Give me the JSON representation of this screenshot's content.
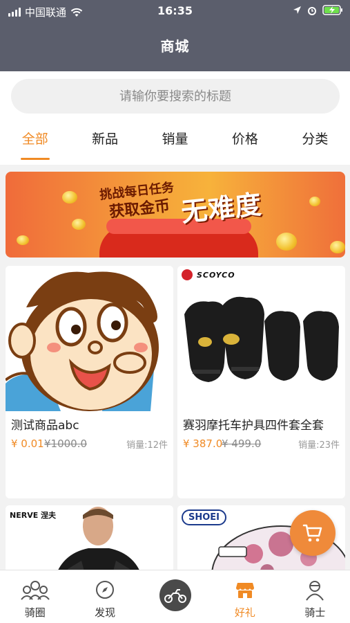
{
  "status_bar": {
    "carrier": "中国联通",
    "time": "16:35"
  },
  "header": {
    "title": "商城"
  },
  "search": {
    "placeholder": "请输你要搜索的标题"
  },
  "tabs": [
    {
      "label": "全部",
      "active": true
    },
    {
      "label": "新品",
      "active": false
    },
    {
      "label": "销量",
      "active": false
    },
    {
      "label": "价格",
      "active": false
    },
    {
      "label": "分类",
      "active": false
    }
  ],
  "banner": {
    "line1": "挑战每日任务",
    "line2": "获取金币",
    "slogan": "无难度"
  },
  "products": [
    {
      "name": "测试商品abc",
      "price": "¥ 0.01",
      "original_price": "¥1000.0",
      "sales": "销量:12件"
    },
    {
      "name": "赛羽摩托车护具四件套全套",
      "price": "¥ 387.0",
      "original_price": "¥ 499.0",
      "sales": "销量:23件",
      "brand": "SCOYCO"
    },
    {
      "brand": "NERVE 涅夫"
    },
    {
      "brand": "SHOEI"
    }
  ],
  "cart_button": {
    "icon": "cart-icon"
  },
  "tab_bar": [
    {
      "label": "骑圈",
      "icon": "riders-group-icon",
      "active": false
    },
    {
      "label": "发现",
      "icon": "compass-icon",
      "active": false
    },
    {
      "label": "",
      "icon": "motorcycle-icon",
      "active": false
    },
    {
      "label": "好礼",
      "icon": "shop-icon",
      "active": true
    },
    {
      "label": "骑士",
      "icon": "rider-icon",
      "active": false
    }
  ],
  "colors": {
    "header_bg": "#5b5e6c",
    "accent": "#f08a24",
    "page_bg": "#f2f2f2"
  }
}
